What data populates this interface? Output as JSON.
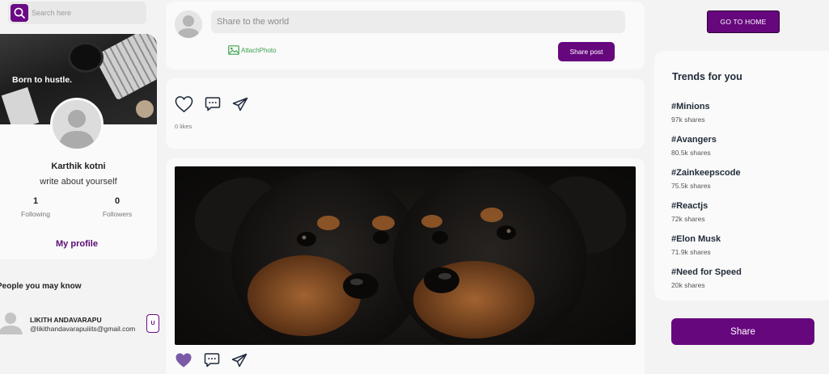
{
  "search": {
    "placeholder": "Search here"
  },
  "profile": {
    "cover_text": "Born to hustle.",
    "name": "Karthik kotni",
    "bio": "write about yourself",
    "following_count": "1",
    "following_label": "Following",
    "followers_count": "0",
    "followers_label": "Followers",
    "my_profile_label": "My profile"
  },
  "people": {
    "title": "People you may know",
    "items": [
      {
        "name": "LIKITH ANDAVARAPU",
        "email": "@likithandavarapuiiits@gmail.com",
        "button_label": "U"
      }
    ]
  },
  "share_box": {
    "placeholder": "Share to the world",
    "attach_label": "AttachPhoto",
    "share_button": "Share post"
  },
  "feed": {
    "first_post": {
      "likes_text": "0 likes"
    }
  },
  "nav": {
    "go_home": "GO TO HOME"
  },
  "trends": {
    "title": "Trends for you",
    "items": [
      {
        "tag": "#Minions",
        "shares": "97k shares"
      },
      {
        "tag": "#Avangers",
        "shares": "80.5k shares"
      },
      {
        "tag": "#Zainkeepscode",
        "shares": "75.5k shares"
      },
      {
        "tag": "#Reactjs",
        "shares": "72k shares"
      },
      {
        "tag": "#Elon Musk",
        "shares": "71.9k shares"
      },
      {
        "tag": "#Need for Speed",
        "shares": "20k shares"
      }
    ]
  },
  "share_button": "Share",
  "colors": {
    "brand": "#66077e",
    "attach_green": "#3aa24a",
    "liked_heart": "#7a5aa6",
    "page_bg": "#f3f3f3",
    "card_bg": "#fafafa"
  }
}
